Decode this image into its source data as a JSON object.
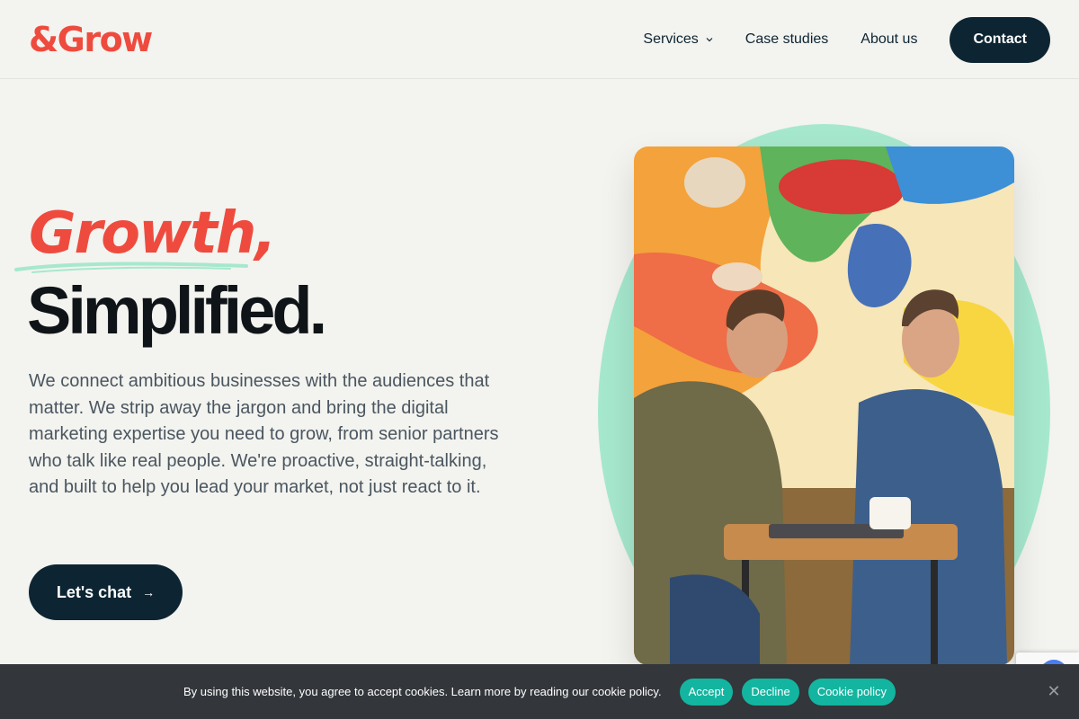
{
  "brand": {
    "logo_text": "&Grow",
    "accent": "#ee4b3e",
    "dark": "#0d2533",
    "mint": "#a6e8ce"
  },
  "nav": {
    "items": [
      {
        "label": "Services",
        "has_dropdown": true
      },
      {
        "label": "Case studies"
      },
      {
        "label": "About us"
      }
    ],
    "contact_label": "Contact"
  },
  "hero": {
    "script_heading": "Growth,",
    "title": "Simplified.",
    "description": "We connect ambitious businesses with the audiences that matter. We strip away the jargon and bring the digital marketing expertise you need to grow, from senior partners who talk like real people. We're proactive, straight-talking, and built to help you lead your market, not just react to it.",
    "cta_label": "Let's chat",
    "cta_icon": "arrow-right-icon"
  },
  "cookie": {
    "message": "By using this website, you agree to accept cookies. Learn more by reading our cookie policy.",
    "accept_label": "Accept",
    "decline_label": "Decline",
    "policy_label": "Cookie policy",
    "close_icon": "close-icon",
    "button_color": "#13b5a0"
  }
}
